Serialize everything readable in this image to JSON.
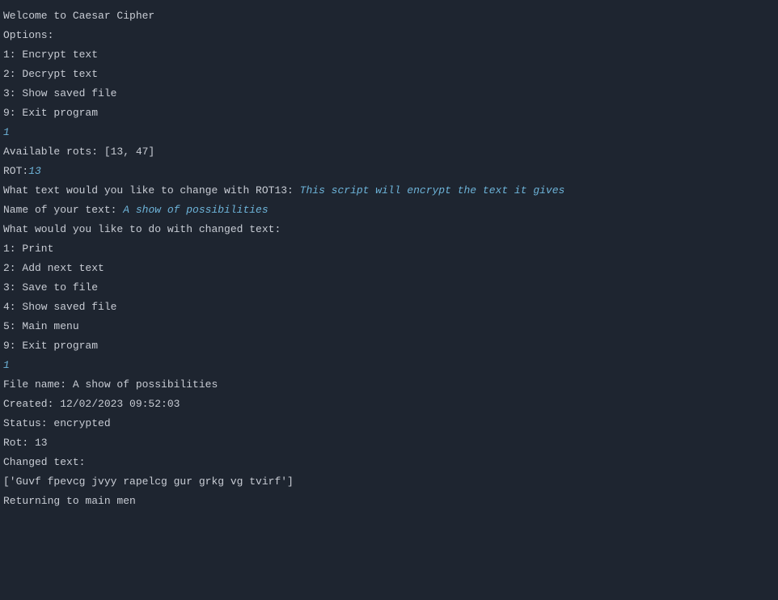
{
  "lines": {
    "welcome": "Welcome to Caesar Cipher",
    "blank": "",
    "options_header": "Options:",
    "opt1": "1: Encrypt text",
    "opt2": "2: Decrypt text",
    "opt3": "3: Show saved file",
    "opt9": "9: Exit program",
    "input_choice1": "1",
    "available_rots": "Available rots: [13, 47]",
    "rot_prompt": "ROT:",
    "rot_input": "13",
    "change_prompt": "What text would you like to change with ROT13: ",
    "change_input": "This script will encrypt the text it gives",
    "name_prompt": "Name of your text: ",
    "name_input": "A show of possibilities",
    "what_do_header": "What would you like to do with changed text:",
    "do1": "1: Print",
    "do2": "2: Add next text",
    "do3": "3: Save to file",
    "do4": "4: Show saved file",
    "do5": "5: Main menu",
    "do9": "9: Exit program",
    "input_choice2": "1",
    "file_name": "File name: A show of possibilities",
    "created": "Created: 12/02/2023 09:52:03",
    "status": "Status: encrypted",
    "rot_val": "Rot: 13",
    "changed_text_label": "Changed text:",
    "changed_text_value": "['Guvf fpevcg jvyy rapelcg gur grkg vg tvirf']",
    "returning": "Returning to main men"
  }
}
